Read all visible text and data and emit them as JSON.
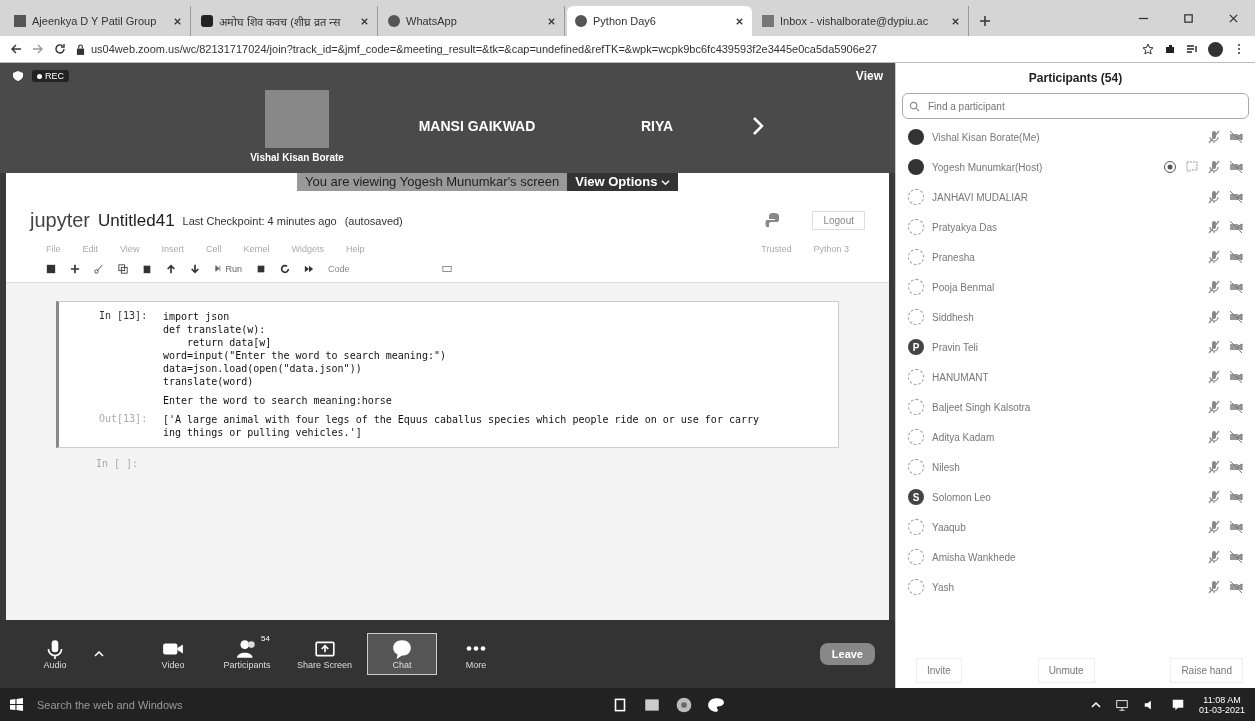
{
  "browser": {
    "tabs": [
      {
        "title": "Ajeenkya D Y Patil Group",
        "kind": "letter",
        "selected": false
      },
      {
        "title": "अमोघ शिव कवच (शीघ्र व्रत न्स",
        "kind": "video",
        "selected": false
      },
      {
        "title": "WhatsApp",
        "kind": "circle",
        "selected": false
      },
      {
        "title": "Python Day6",
        "kind": "circle",
        "selected": true
      },
      {
        "title": "Inbox - vishalborate@dypiu.ac",
        "kind": "mail",
        "selected": false
      }
    ],
    "url": "us04web.zoom.us/wc/82131717024/join?track_id=&jmf_code=&meeting_result=&tk=&cap=undefined&refTK=&wpk=wcpk9bc6fc439593f2e3445e0ca5da5906e27"
  },
  "meeting": {
    "rec": "REC",
    "view": "View",
    "tiles": [
      {
        "name": "Vishal Kisan Borate",
        "kind": "photo"
      },
      {
        "name": "MANSI GAIKWAD",
        "kind": "name"
      },
      {
        "name": "RIYA",
        "kind": "name"
      }
    ],
    "banner": "You are viewing Yogesh Munumkar's screen",
    "view_options": "View Options"
  },
  "notebook": {
    "logo": "jupyter",
    "title": "Untitled41",
    "checkpoint": "Last Checkpoint: 4 minutes ago",
    "saved": "(autosaved)",
    "logout": "Logout",
    "menu": [
      "File",
      "Edit",
      "View",
      "Insert",
      "Cell",
      "Kernel",
      "Widgets",
      "Help"
    ],
    "trusted": "Trusted",
    "kernel": "Python 3",
    "run": "Run",
    "cell_type": "Code",
    "cell": {
      "prompt": "In [13]:",
      "code": [
        "import json",
        "def translate(w):",
        "    return data[w]",
        "word=input(\"Enter the word to search meaning:\")",
        "data=json.load(open(\"data.json\"))",
        "translate(word)"
      ],
      "stdout": "Enter the word to search meaning:horse",
      "out_prompt": "Out[13]:",
      "result": "['A large animal with four legs of the Equus caballus species which people ride on or use for carrying things or pulling vehicles.']"
    },
    "empty_prompt": "In [ ]:"
  },
  "toolbar": [
    {
      "label": "Audio",
      "kind": "mic",
      "selected": false
    },
    {
      "label": "Video",
      "kind": "camera",
      "selected": false
    },
    {
      "label": "Participants",
      "kind": "people",
      "badge": "54",
      "selected": false
    },
    {
      "label": "Share Screen",
      "kind": "share",
      "selected": false
    },
    {
      "label": "Chat",
      "kind": "chat",
      "selected": true
    },
    {
      "label": "More",
      "kind": "more",
      "selected": false
    }
  ],
  "leave": "Leave",
  "participants": {
    "title": "Participants (54)",
    "search": {
      "placeholder": "Find a participant"
    },
    "people": [
      {
        "name": "Vishal Kisan Borate(Me)",
        "kind": "photo",
        "host": false
      },
      {
        "name": "Yogesh Munumkar(Host)",
        "kind": "photo",
        "host": true
      },
      {
        "name": "JANHAVI MUDALIAR",
        "kind": "default",
        "host": false
      },
      {
        "name": "Pratyakya Das",
        "kind": "default",
        "host": false
      },
      {
        "name": "Pranesha",
        "kind": "default",
        "host": false
      },
      {
        "name": "Pooja Benmal",
        "kind": "default",
        "host": false
      },
      {
        "name": "Siddhesh",
        "kind": "default",
        "host": false
      },
      {
        "name": "Pravin Teli",
        "kind": "initial",
        "initial": "P",
        "host": false
      },
      {
        "name": "HANUMANT",
        "kind": "default",
        "host": false
      },
      {
        "name": "Baljeet Singh Kalsotra",
        "kind": "default",
        "host": false
      },
      {
        "name": "Aditya Kadam",
        "kind": "default",
        "host": false
      },
      {
        "name": "Nilesh",
        "kind": "default",
        "host": false
      },
      {
        "name": "Solomon Leo",
        "kind": "initial",
        "initial": "S",
        "host": false
      },
      {
        "name": "Yaaqub",
        "kind": "default",
        "host": false
      },
      {
        "name": "Amisha Wankhede",
        "kind": "default",
        "host": false
      },
      {
        "name": "Yash",
        "kind": "default",
        "host": false
      }
    ],
    "buttons": [
      "Invite",
      "Unmute",
      "Raise hand"
    ]
  },
  "taskbar": {
    "search": "Search the web and Windows",
    "time": "11:08 AM",
    "date": "01-03-2021"
  }
}
